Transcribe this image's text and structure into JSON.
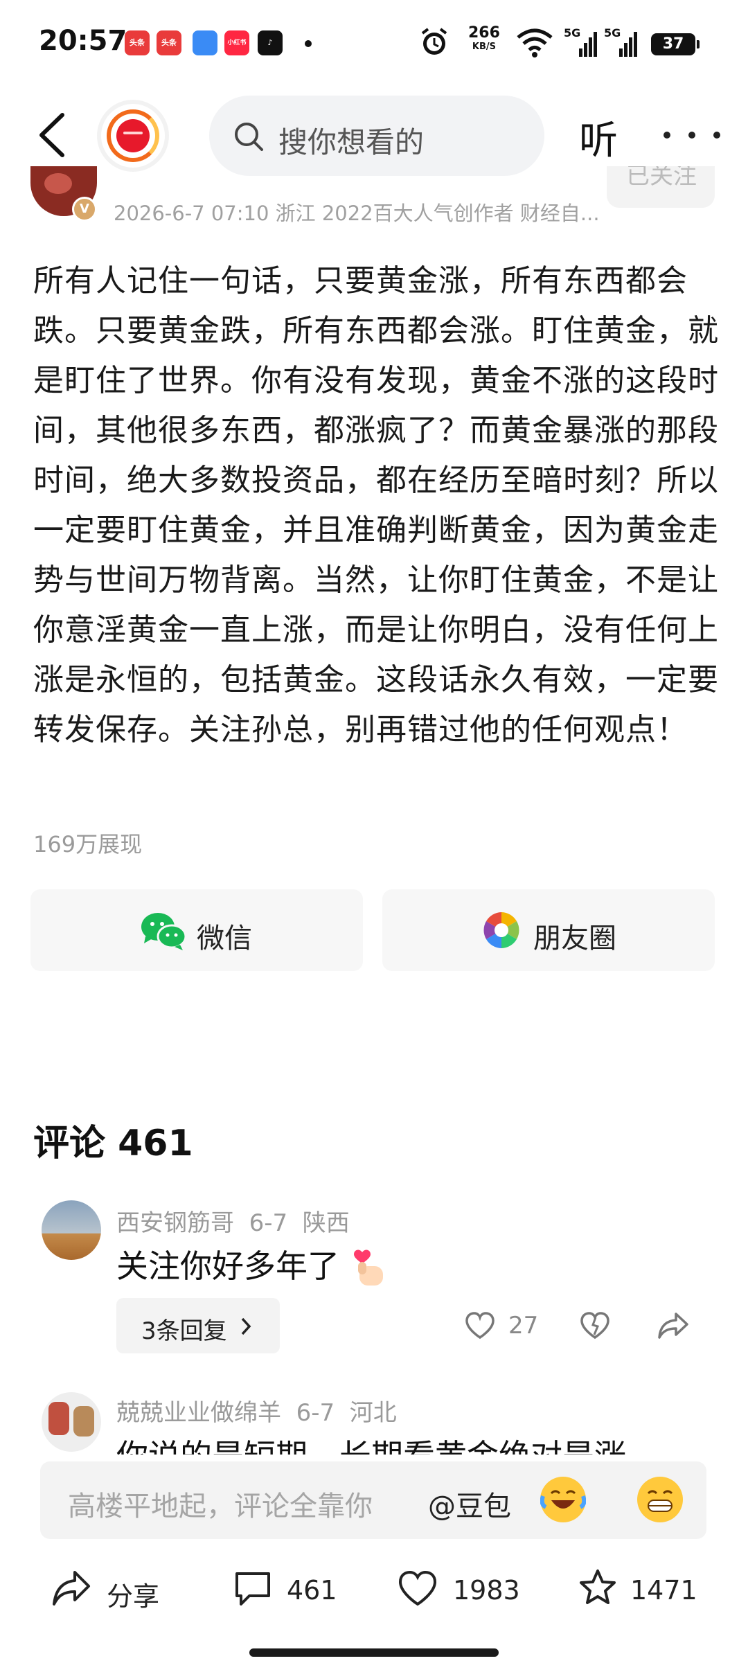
{
  "status_bar": {
    "time": "20:57",
    "apps": [
      {
        "label": "头条",
        "color": "#e93b3b"
      },
      {
        "label": "头条",
        "color": "#e93b3b"
      },
      {
        "label": "",
        "color": "#3a8bf5"
      },
      {
        "label": "小红书",
        "color": "#ff2742"
      },
      {
        "label": "",
        "color": "#111111"
      }
    ],
    "net_speed": "266",
    "net_unit": "KB/S",
    "signal_1": "5G",
    "signal_2": "5G",
    "battery": "37"
  },
  "header": {
    "search_placeholder": "搜你想看的",
    "listen_label": "听"
  },
  "author": {
    "meta": "2026-6-7 07:10  浙江  2022百大人气创作者 财经自...",
    "badge": "V",
    "follow_label": "已关注"
  },
  "post": {
    "content": "所有人记住一句话，只要黄金涨，所有东西都会跌。只要黄金跌，所有东西都会涨。盯住黄金，就是盯住了世界。你有没有发现，黄金不涨的这段时间，其他很多东西，都涨疯了？而黄金暴涨的那段时间，绝大多数投资品，都在经历至暗时刻？所以一定要盯住黄金，并且准确判断黄金，因为黄金走势与世间万物背离。当然，让你盯住黄金，不是让你意淫黄金一直上涨，而是让你明白，没有任何上涨是永恒的，包括黄金。这段话永久有效，一定要转发保存。关注孙总，别再错过他的任何观点！",
    "views": "169万展现"
  },
  "share": {
    "wechat": "微信",
    "moments": "朋友圈"
  },
  "comments": {
    "title": "评论 461",
    "items": [
      {
        "user": "西安钢筋哥",
        "date": "6-7",
        "location": "陕西",
        "text": "关注你好多年了",
        "replies": "3条回复",
        "likes": "27"
      },
      {
        "user": "兢兢业业做绵羊",
        "date": "6-7",
        "location": "河北",
        "text": "你说的是短期，长期看黄金绝对是涨"
      }
    ]
  },
  "input": {
    "placeholder": "高楼平地起，评论全靠你",
    "mention": "@豆包"
  },
  "bottom_bar": {
    "share": "分享",
    "comments": "461",
    "likes": "1983",
    "favorites": "1471"
  }
}
